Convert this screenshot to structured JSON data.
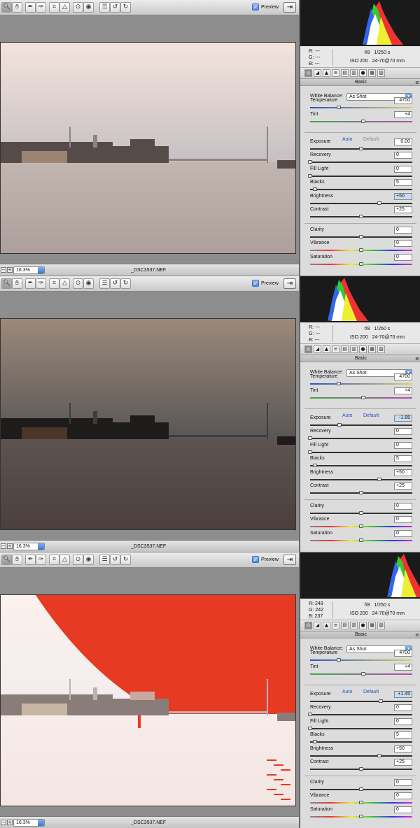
{
  "common": {
    "preview_label": "Preview",
    "zoom": "16.3%",
    "filename": "_DSC3537.NEF",
    "aperture": "f/8",
    "shutter": "1/250 s",
    "iso": "ISO 200",
    "lens": "24-70@70 mm",
    "section_title": "Basic",
    "white_balance_label": "White Balance:",
    "white_balance_value": "As Shot",
    "auto_label": "Auto",
    "default_label": "Default",
    "labels": {
      "temperature": "Temperature",
      "tint": "Tint",
      "exposure": "Exposure",
      "recovery": "Recovery",
      "fill_light": "Fill Light",
      "blacks": "Blacks",
      "brightness": "Brightness",
      "contrast": "Contrast",
      "clarity": "Clarity",
      "vibrance": "Vibrance",
      "saturation": "Saturation"
    },
    "colors": {
      "accent": "#3b74d1",
      "clipping": "#e63a22",
      "link": "#2252c4"
    }
  },
  "panels": [
    {
      "rgb": {
        "r": "R:  ---",
        "g": "G:  ---",
        "b": "B:  ---"
      },
      "values": {
        "temperature": "4700",
        "tint": "+4",
        "exposure": "0.00",
        "recovery": "0",
        "fill_light": "0",
        "blacks": "5",
        "brightness": "+50",
        "contrast": "+25",
        "clarity": "0",
        "vibrance": "0",
        "saturation": "0"
      },
      "highlighted_value": "brightness",
      "auto_active": true
    },
    {
      "rgb": {
        "r": "R:  ---",
        "g": "G:  ---",
        "b": "B:  ---"
      },
      "values": {
        "temperature": "4700",
        "tint": "+4",
        "exposure": "-1.85",
        "recovery": "0",
        "fill_light": "0",
        "blacks": "5",
        "brightness": "+50",
        "contrast": "+25",
        "clarity": "0",
        "vibrance": "0",
        "saturation": "0"
      },
      "highlighted_value": "exposure",
      "auto_active": true
    },
    {
      "rgb": {
        "r": "R:  249",
        "g": "G:  242",
        "b": "B:  237"
      },
      "values": {
        "temperature": "4700",
        "tint": "+4",
        "exposure": "+1.45",
        "recovery": "0",
        "fill_light": "0",
        "blacks": "5",
        "brightness": "+50",
        "contrast": "+25",
        "clarity": "0",
        "vibrance": "0",
        "saturation": "0"
      },
      "highlighted_value": "exposure",
      "auto_active": true
    }
  ]
}
